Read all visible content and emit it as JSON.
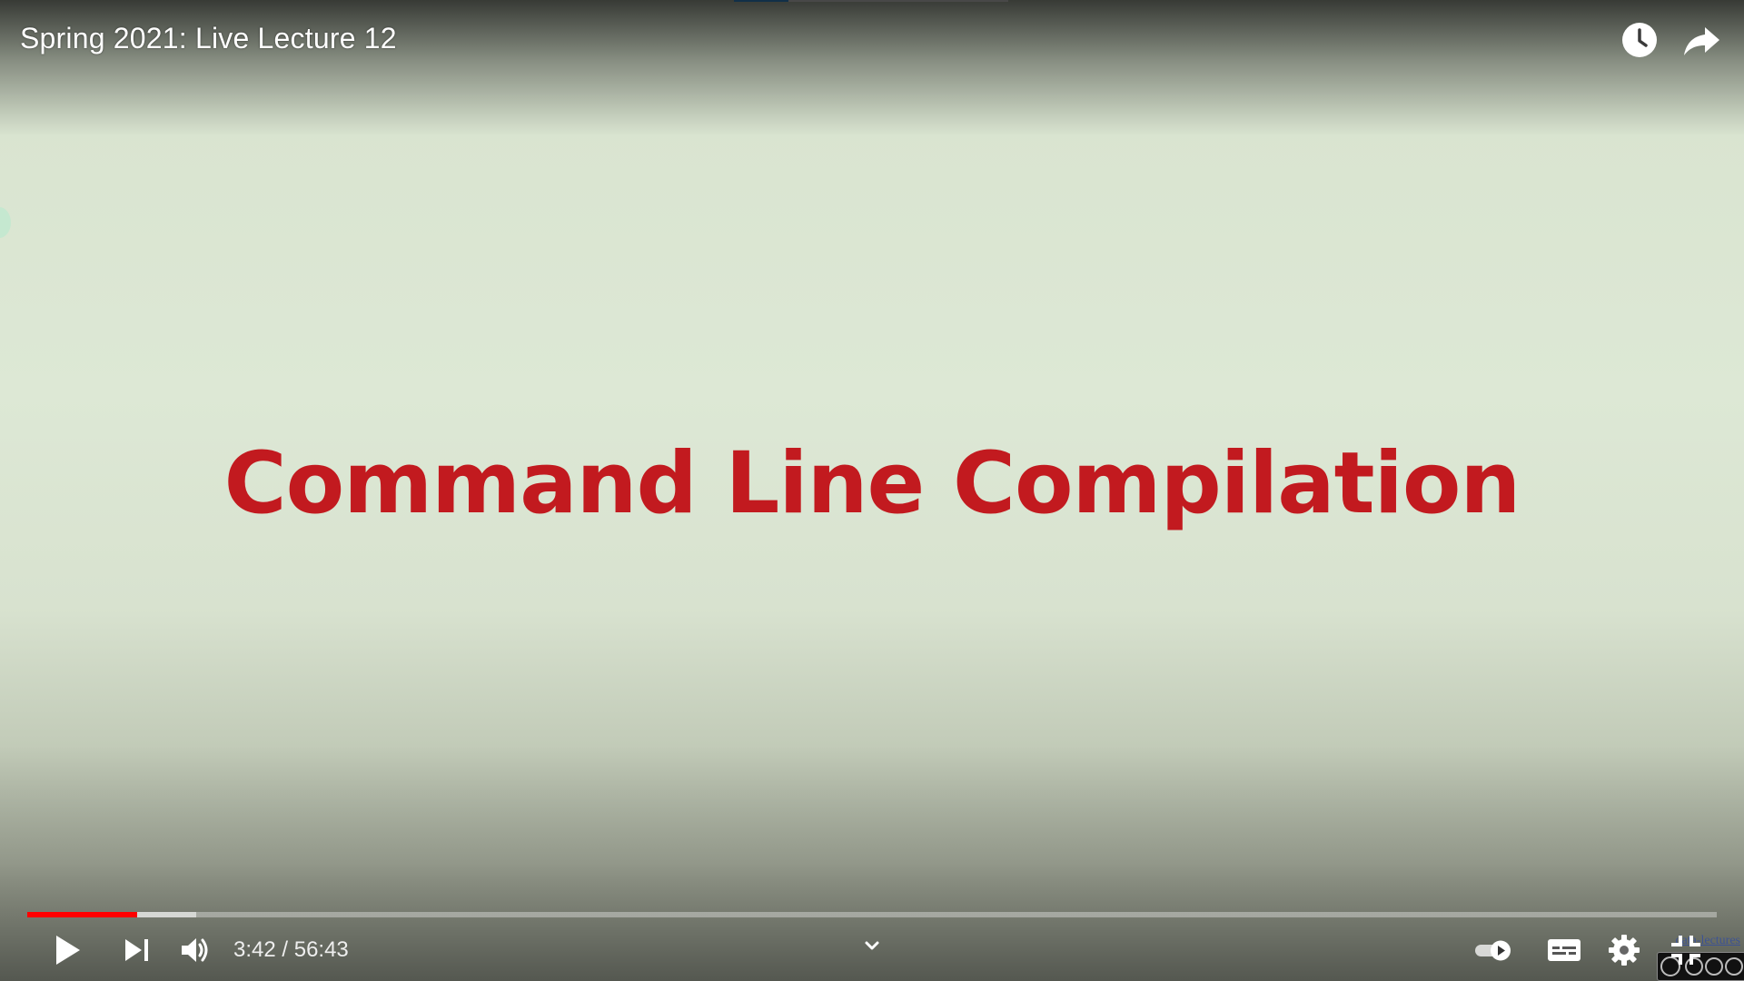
{
  "video": {
    "title": "Spring 2021: Live Lecture 12",
    "slide_heading": "Command Line Compilation",
    "slide_heading_color": "#c21a1f"
  },
  "top_controls": {
    "watch_later_icon": "clock-icon",
    "share_icon": "share-arrow-icon"
  },
  "progress": {
    "played_fraction": 0.065,
    "buffered_fraction": 0.1,
    "played_color": "#ff0000"
  },
  "controls": {
    "play_icon": "play-icon",
    "next_icon": "skip-next-icon",
    "volume_icon": "volume-icon",
    "current_time": "3:42",
    "duration": "56:43",
    "time_text": "3:42 / 56:43",
    "chevron_icon": "chevron-down-icon",
    "autoplay_icon": "autoplay-toggle-icon",
    "subtitles_icon": "subtitles-icon",
    "settings_icon": "gear-icon",
    "fullscreen_icon": "exit-fullscreen-icon"
  },
  "watermark": {
    "text": "data-lectures"
  }
}
